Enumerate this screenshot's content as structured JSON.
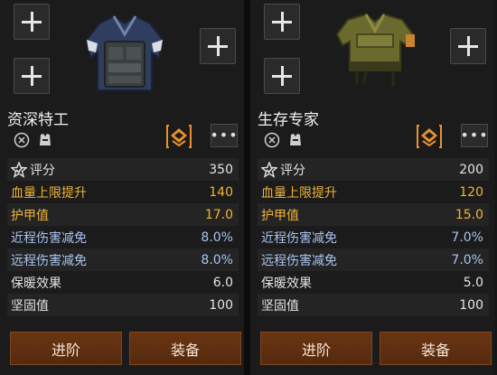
{
  "colors": {
    "gold": "#f1b43a",
    "blue": "#a9c3ef",
    "button": "#6a3513",
    "badge": "#e8912e"
  },
  "cards": [
    {
      "name": "资深特工",
      "stats": [
        {
          "label": "评分",
          "value": "350",
          "tone": "white",
          "icon": "star-check-icon"
        },
        {
          "label": "血量上限提升",
          "value": "140",
          "tone": "gold"
        },
        {
          "label": "护甲值",
          "value": "17.0",
          "tone": "gold"
        },
        {
          "label": "近程伤害减免",
          "value": "8.0%",
          "tone": "blue"
        },
        {
          "label": "远程伤害减免",
          "value": "8.0%",
          "tone": "blue"
        },
        {
          "label": "保暖效果",
          "value": "6.0",
          "tone": "white"
        },
        {
          "label": "坚固值",
          "value": "100",
          "tone": "white"
        }
      ],
      "buttons": {
        "advance": "进阶",
        "equip": "装备"
      },
      "more": "•••"
    },
    {
      "name": "生存专家",
      "stats": [
        {
          "label": "评分",
          "value": "200",
          "tone": "white",
          "icon": "star-check-icon"
        },
        {
          "label": "血量上限提升",
          "value": "120",
          "tone": "gold"
        },
        {
          "label": "护甲值",
          "value": "15.0",
          "tone": "gold"
        },
        {
          "label": "近程伤害减免",
          "value": "7.0%",
          "tone": "blue"
        },
        {
          "label": "远程伤害减免",
          "value": "7.0%",
          "tone": "blue"
        },
        {
          "label": "保暖效果",
          "value": "5.0",
          "tone": "white"
        },
        {
          "label": "坚固值",
          "value": "100",
          "tone": "white"
        }
      ],
      "buttons": {
        "advance": "进阶",
        "equip": "装备"
      },
      "more": "•••"
    }
  ]
}
